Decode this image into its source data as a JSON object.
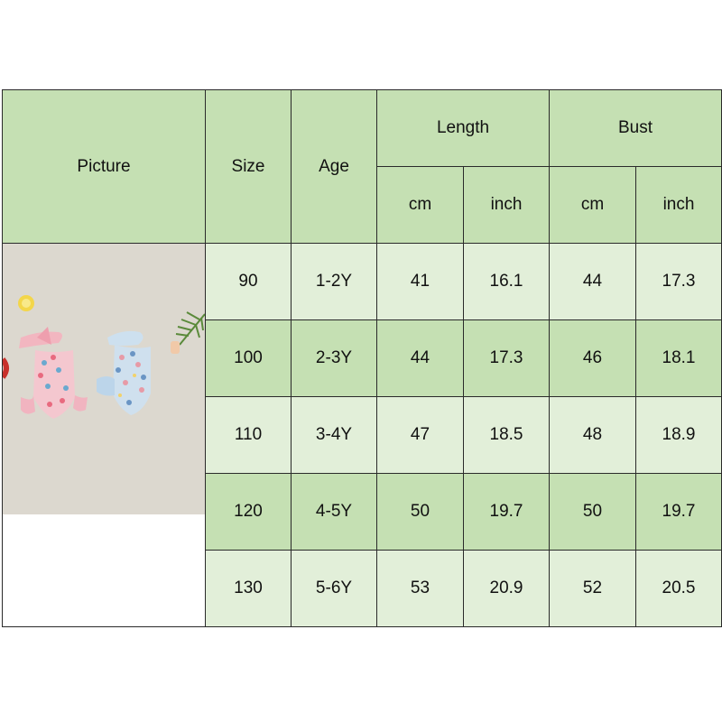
{
  "headers": {
    "picture": "Picture",
    "size": "Size",
    "age": "Age",
    "length": "Length",
    "bust": "Bust",
    "length_cm": "cm",
    "length_inch": "inch",
    "bust_cm": "cm",
    "bust_inch": "inch"
  },
  "rows": [
    {
      "size": "90",
      "age": "1-2Y",
      "length_cm": "41",
      "length_inch": "16.1",
      "bust_cm": "44",
      "bust_inch": "17.3"
    },
    {
      "size": "100",
      "age": "2-3Y",
      "length_cm": "44",
      "length_inch": "17.3",
      "bust_cm": "46",
      "bust_inch": "18.1"
    },
    {
      "size": "110",
      "age": "3-4Y",
      "length_cm": "47",
      "length_inch": "18.5",
      "bust_cm": "48",
      "bust_inch": "18.9"
    },
    {
      "size": "120",
      "age": "4-5Y",
      "length_cm": "50",
      "length_inch": "19.7",
      "bust_cm": "50",
      "bust_inch": "19.7"
    },
    {
      "size": "130",
      "age": "5-6Y",
      "length_cm": "53",
      "length_inch": "20.9",
      "bust_cm": "52",
      "bust_inch": "20.5"
    }
  ],
  "colors": {
    "header_green": "#c5e0b3",
    "row_light": "#e2efd9",
    "row_dark": "#c5e0b3",
    "border": "#2a2a2a"
  }
}
